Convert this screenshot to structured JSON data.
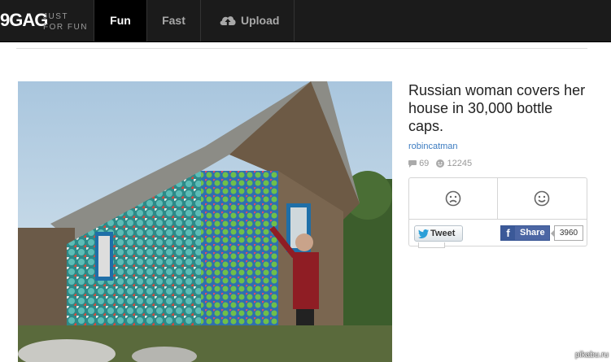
{
  "header": {
    "logo": "9GAG",
    "tagline_line1": "JUST",
    "tagline_line2": "FOR FUN",
    "tabs": [
      {
        "label": "Fun",
        "active": true
      },
      {
        "label": "Fast",
        "active": false
      },
      {
        "label": "Upload",
        "active": false,
        "icon": "cloud-upload-icon"
      }
    ]
  },
  "post": {
    "title": "Russian woman covers her house in 30,000 bottle caps.",
    "author": "robincatman",
    "comments": "69",
    "points": "12245",
    "image_description_icon": "photo"
  },
  "vote": {
    "down_icon": "frown-icon",
    "up_icon": "smile-icon"
  },
  "share": {
    "tweet_label": "Tweet",
    "fb_label": "Share",
    "fb_count": "3960"
  },
  "watermark": "pikabu.ru",
  "colors": {
    "nav_bg": "#1b1b1b",
    "active_tab_bg": "#000000",
    "link": "#3b7bc0",
    "facebook": "#4c66a4"
  }
}
